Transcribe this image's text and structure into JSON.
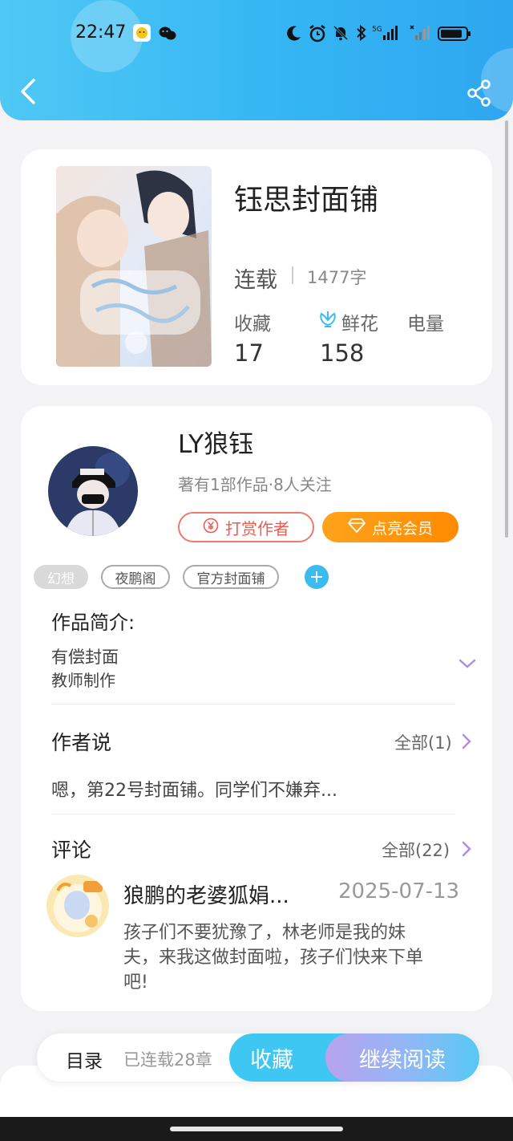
{
  "status_bar": {
    "time": "22:47",
    "network": "5G"
  },
  "book": {
    "title": "钰思封面铺",
    "status": "连载",
    "word_count": "1477字",
    "stats": [
      {
        "label": "收藏",
        "value": "17"
      },
      {
        "label": "鲜花",
        "value": "158"
      },
      {
        "label": "电量",
        "value": ""
      }
    ]
  },
  "author": {
    "name": "LY狼钰",
    "meta": "著有1部作品·8人关注",
    "reward_label": "打赏作者",
    "vip_label": "点亮会员"
  },
  "tags": [
    "幻想",
    "夜鹏阁",
    "官方封面铺"
  ],
  "tag_add_label": "+",
  "intro": {
    "title": "作品简介:",
    "lines": [
      "有偿封面",
      "教师制作"
    ]
  },
  "author_says": {
    "title": "作者说",
    "more": "全部(1)",
    "preview": "嗯，第22号封面铺。同学们不嫌弃..."
  },
  "comments": {
    "title": "评论",
    "more": "全部(22)",
    "items": [
      {
        "name": "狼鹏的老婆狐娟...",
        "date": "2025-07-13",
        "lines": [
          "孩子们不要犹豫了，林老师是我的妹",
          "夫，来我这做封面啦，孩子们快来下单",
          "吧!"
        ]
      }
    ]
  },
  "bottom_bar": {
    "toc": "目录",
    "chapters": "已连载28章",
    "favorite": "收藏",
    "continue": "继续阅读"
  },
  "colors": {
    "header_blue": "#35b6f3",
    "reward_red": "#ee5b50",
    "vip_orange": "#ff8a00",
    "accent_blue": "#3ec7f2",
    "chevron_purple": "#b08ee0"
  },
  "icons": {
    "back": "chevron-left-icon",
    "share": "share-icon",
    "flower": "flower-icon",
    "yuan": "yuan-coin-icon",
    "diamond": "diamond-icon",
    "expand": "chevron-down-icon",
    "more": "chevron-right-icon"
  }
}
